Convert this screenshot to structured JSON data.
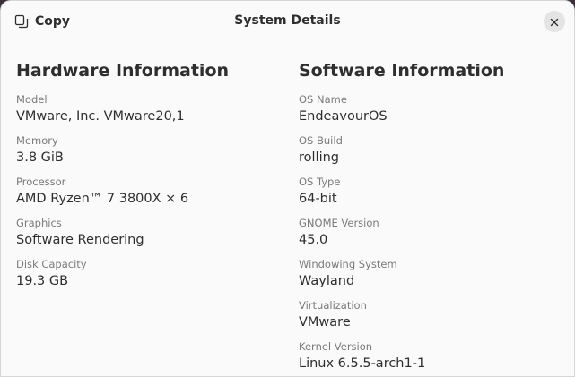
{
  "header": {
    "copy_label": "Copy",
    "title": "System Details",
    "copy_icon": "copy-icon",
    "close_icon": "close-icon"
  },
  "hardware": {
    "title": "Hardware Information",
    "fields": [
      {
        "label": "Model",
        "value": "VMware, Inc. VMware20,1"
      },
      {
        "label": "Memory",
        "value": "3.8 GiB"
      },
      {
        "label": "Processor",
        "value": "AMD Ryzen™ 7 3800X × 6"
      },
      {
        "label": "Graphics",
        "value": "Software Rendering"
      },
      {
        "label": "Disk Capacity",
        "value": "19.3 GB"
      }
    ]
  },
  "software": {
    "title": "Software Information",
    "fields": [
      {
        "label": "OS Name",
        "value": "EndeavourOS"
      },
      {
        "label": "OS Build",
        "value": "rolling"
      },
      {
        "label": "OS Type",
        "value": "64-bit"
      },
      {
        "label": "GNOME Version",
        "value": "45.0"
      },
      {
        "label": "Windowing System",
        "value": "Wayland"
      },
      {
        "label": "Virtualization",
        "value": "VMware"
      },
      {
        "label": "Kernel Version",
        "value": "Linux 6.5.5-arch1-1"
      }
    ]
  },
  "colors": {
    "window_bg": "#fafafa",
    "text_primary": "#2e2e2e",
    "text_secondary": "#7a7a7a",
    "close_button_bg": "#e4e4e4"
  }
}
